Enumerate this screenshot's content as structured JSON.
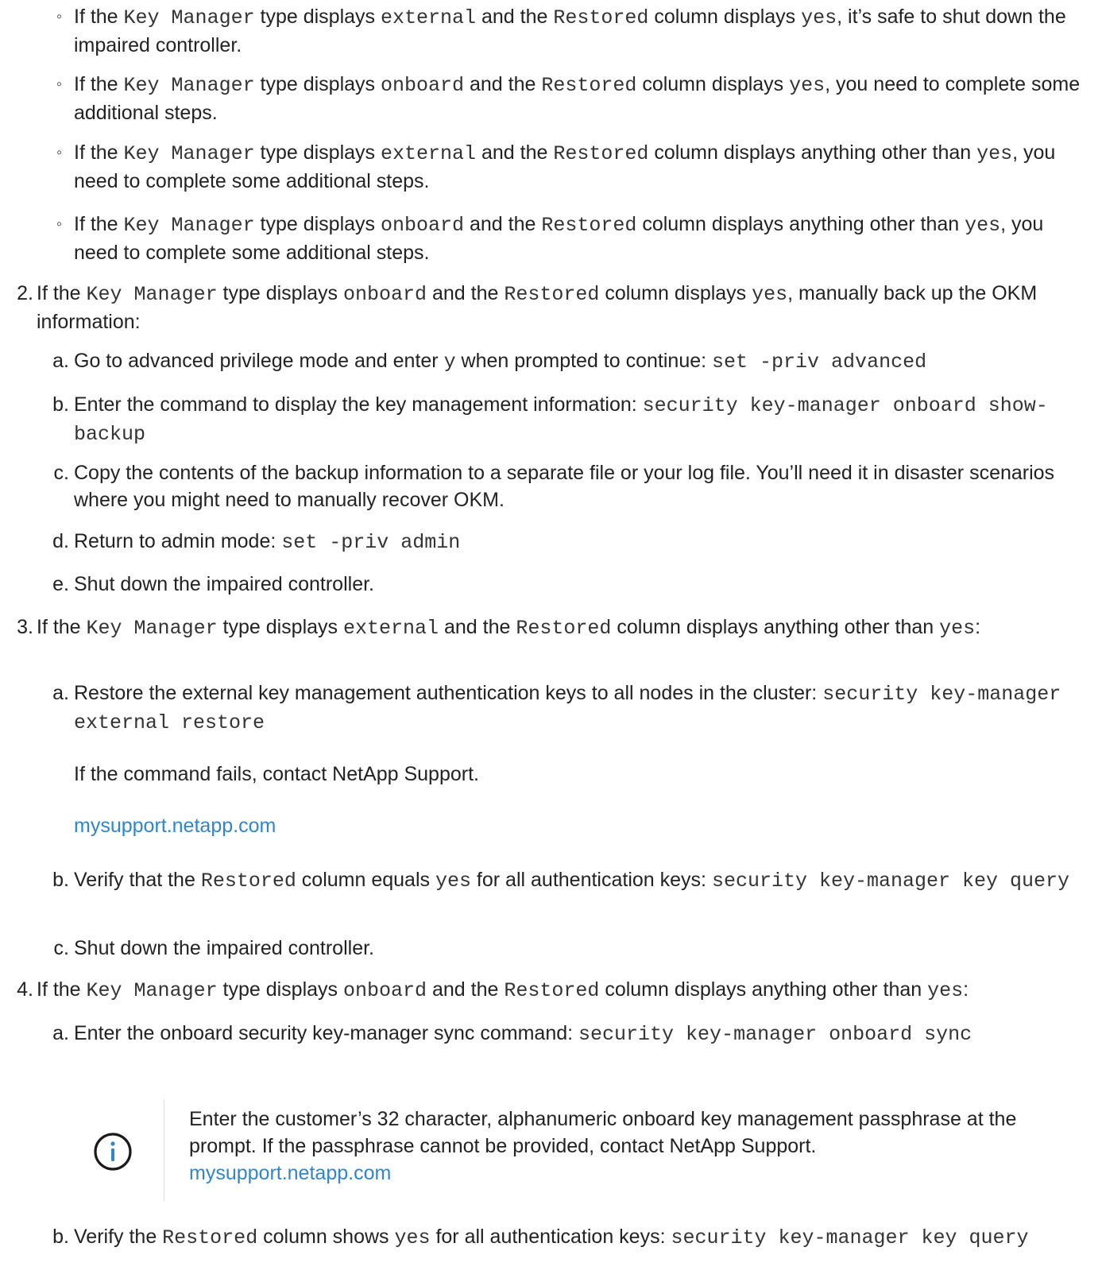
{
  "bullets": [
    {
      "parts": [
        {
          "t": "If the "
        },
        {
          "c": "Key Manager"
        },
        {
          "t": " type displays "
        },
        {
          "c": "external"
        },
        {
          "t": " and the "
        },
        {
          "c": "Restored"
        },
        {
          "t": " column displays "
        },
        {
          "c": "yes"
        },
        {
          "t": ", it’s safe to shut down the impaired controller."
        }
      ]
    },
    {
      "parts": [
        {
          "t": "If the "
        },
        {
          "c": "Key Manager"
        },
        {
          "t": " type displays "
        },
        {
          "c": "onboard"
        },
        {
          "t": " and the "
        },
        {
          "c": "Restored"
        },
        {
          "t": " column displays "
        },
        {
          "c": "yes"
        },
        {
          "t": ", you need to complete some additional steps."
        }
      ]
    },
    {
      "parts": [
        {
          "t": "If the "
        },
        {
          "c": "Key Manager"
        },
        {
          "t": " type displays "
        },
        {
          "c": "external"
        },
        {
          "t": " and the "
        },
        {
          "c": "Restored"
        },
        {
          "t": " column displays anything other than "
        },
        {
          "c": "yes"
        },
        {
          "t": ", you need to complete some additional steps."
        }
      ]
    },
    {
      "parts": [
        {
          "t": "If the "
        },
        {
          "c": "Key Manager"
        },
        {
          "t": " type displays "
        },
        {
          "c": "onboard"
        },
        {
          "t": " and the "
        },
        {
          "c": "Restored"
        },
        {
          "t": " column displays anything other than "
        },
        {
          "c": "yes"
        },
        {
          "t": ", you need to complete some additional steps."
        }
      ]
    }
  ],
  "bullet_mark": "◦",
  "step2": {
    "label": "2.",
    "parts": [
      {
        "t": "If the "
      },
      {
        "c": "Key Manager"
      },
      {
        "t": " type displays "
      },
      {
        "c": "onboard"
      },
      {
        "t": " and the "
      },
      {
        "c": "Restored"
      },
      {
        "t": " column displays "
      },
      {
        "c": "yes"
      },
      {
        "t": ", manually back up the OKM information:"
      }
    ],
    "subs": [
      {
        "label": "a.",
        "parts": [
          {
            "t": "Go to advanced privilege mode and enter "
          },
          {
            "c": "y"
          },
          {
            "t": " when prompted to continue: "
          },
          {
            "c": "set -priv advanced"
          }
        ]
      },
      {
        "label": "b.",
        "parts": [
          {
            "t": "Enter the command to display the key management information: "
          },
          {
            "c": "security key-manager onboard show-backup"
          }
        ]
      },
      {
        "label": "c.",
        "parts": [
          {
            "t": "Copy the contents of the backup information to a separate file or your log file. You’ll need it in disaster scenarios where you might need to manually recover OKM."
          }
        ]
      },
      {
        "label": "d.",
        "parts": [
          {
            "t": "Return to admin mode: "
          },
          {
            "c": "set -priv admin"
          }
        ]
      },
      {
        "label": "e.",
        "parts": [
          {
            "t": "Shut down the impaired controller."
          }
        ]
      }
    ]
  },
  "step3": {
    "label": "3.",
    "parts": [
      {
        "t": "If the "
      },
      {
        "c": "Key Manager"
      },
      {
        "t": " type displays "
      },
      {
        "c": "external"
      },
      {
        "t": " and the "
      },
      {
        "c": "Restored"
      },
      {
        "t": " column displays anything other than "
      },
      {
        "c": "yes"
      },
      {
        "t": ":"
      }
    ],
    "subs": [
      {
        "label": "a.",
        "parts": [
          {
            "t": "Restore the external key management authentication keys to all nodes in the cluster: "
          },
          {
            "c": "security key-manager external restore"
          }
        ]
      },
      {
        "label": "b.",
        "parts": [
          {
            "t": "Verify that the "
          },
          {
            "c": "Restored"
          },
          {
            "t": " column equals "
          },
          {
            "c": "yes"
          },
          {
            "t": " for all authentication keys: "
          },
          {
            "c": "security key-manager key query"
          }
        ]
      },
      {
        "label": "c.",
        "parts": [
          {
            "t": "Shut down the impaired controller."
          }
        ]
      }
    ],
    "fail_text": "If the command fails, contact NetApp Support.",
    "support_link": "mysupport.netapp.com"
  },
  "step4": {
    "label": "4.",
    "parts": [
      {
        "t": "If the "
      },
      {
        "c": "Key Manager"
      },
      {
        "t": " type displays "
      },
      {
        "c": "onboard"
      },
      {
        "t": " and the "
      },
      {
        "c": "Restored"
      },
      {
        "t": " column displays anything other than "
      },
      {
        "c": "yes"
      },
      {
        "t": ":"
      }
    ],
    "subs": [
      {
        "label": "a.",
        "parts": [
          {
            "t": "Enter the onboard security key-manager sync command: "
          },
          {
            "c": "security key-manager onboard sync"
          }
        ]
      },
      {
        "label": "b.",
        "parts": [
          {
            "t": "Verify the "
          },
          {
            "c": "Restored"
          },
          {
            "t": " column shows "
          },
          {
            "c": "yes"
          },
          {
            "t": " for all authentication keys: "
          },
          {
            "c": "security key-manager key query"
          }
        ]
      }
    ],
    "note": {
      "icon": "info-icon",
      "icon_color": "#1a1a1a",
      "text": "Enter the customer’s 32 character, alphanumeric onboard key management passphrase at the prompt. If the passphrase cannot be provided, contact NetApp Support.",
      "link": "mysupport.netapp.com"
    }
  },
  "colors": {
    "text": "#222222",
    "link": "#2f86c9",
    "divider": "#dcdcdc"
  }
}
